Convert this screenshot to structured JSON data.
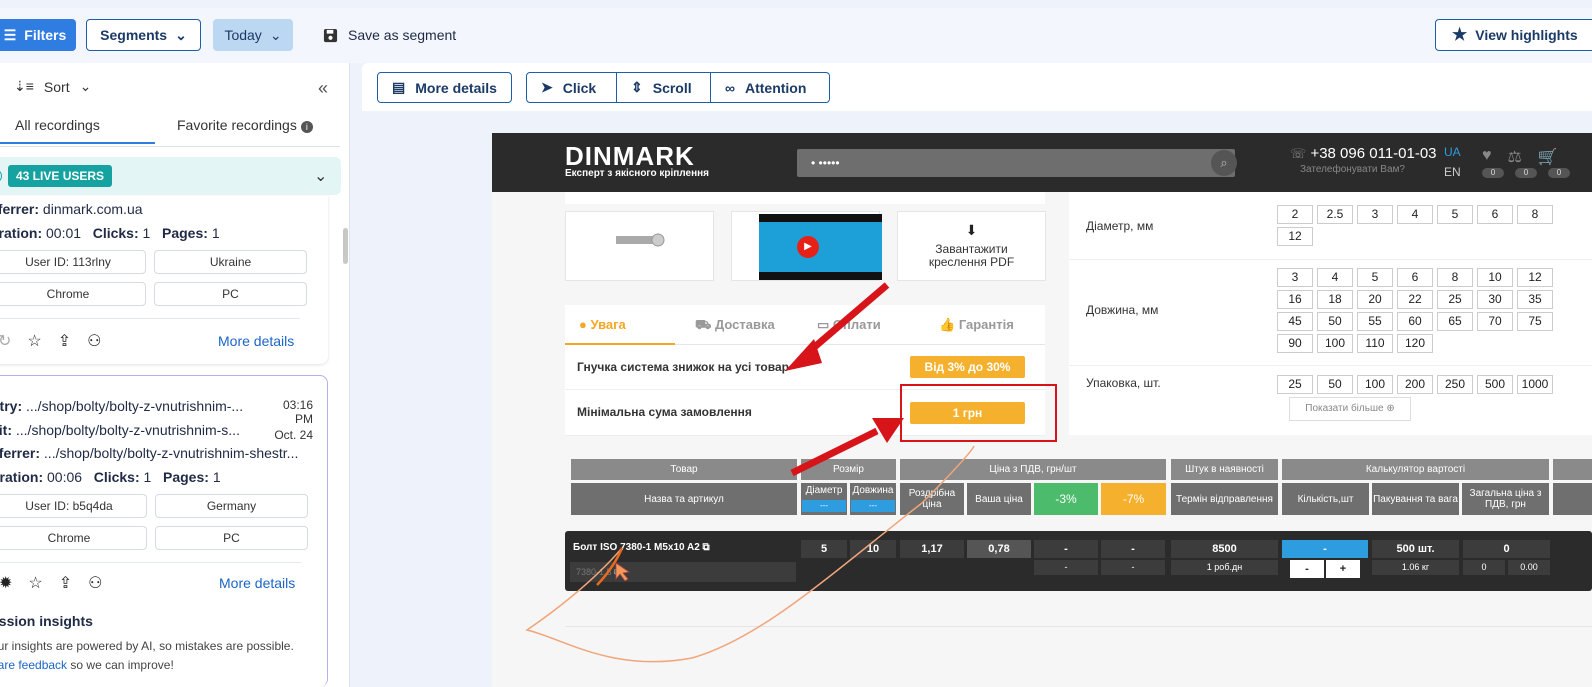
{
  "topbar": {
    "filters_label": "Filters",
    "segments_label": "Segments",
    "today_label": "Today",
    "save_segment_label": "Save as segment",
    "view_highlights_label": "View highlights"
  },
  "sidebar": {
    "sort_label": "Sort",
    "tab_all": "All recordings",
    "tab_favorite": "Favorite recordings",
    "live_users": "43 LIVE USERS",
    "session1": {
      "referrer_label": "eferrer:",
      "referrer": "dinmark.com.ua",
      "duration_label": "uration:",
      "duration": "00:01",
      "clicks_label": "Clicks:",
      "clicks": "1",
      "pages_label": "Pages:",
      "pages": "1",
      "user_id": "User ID: 113rlny",
      "country": "Ukraine",
      "browser": "Chrome",
      "device": "PC",
      "more_details": "More details"
    },
    "session2": {
      "entry_label": "ntry:",
      "entry": ".../shop/bolty/bolty-z-vnutrishnim-...",
      "exit_label": "xit:",
      "exit": ".../shop/bolty/bolty-z-vnutrishnim-s...",
      "referrer_label": "eferrer:",
      "referrer": ".../shop/bolty/bolty-z-vnutrishnim-shestr...",
      "time": "03:16 PM",
      "date": "Oct. 24",
      "duration_label": "uration:",
      "duration": "00:06",
      "clicks_label": "Clicks:",
      "clicks": "1",
      "pages_label": "Pages:",
      "pages": "1",
      "user_id": "User ID: b5q4da",
      "country": "Germany",
      "browser": "Chrome",
      "device": "PC",
      "more_details": "More details",
      "insights_title": "ession insights",
      "insights_text": "our insights are powered by AI, so mistakes are possible.",
      "feedback_link": "hare feedback",
      "feedback_rest": " so we can improve!"
    }
  },
  "player": {
    "more_details": "More details",
    "click": "Click",
    "scroll": "Scroll",
    "attention": "Attention"
  },
  "site": {
    "logo": "DINMARK",
    "logo_sub": "Експерт з якісного кріплення",
    "search_placeholder": "• •••••",
    "phone": "+38 096 011-01-03",
    "phone_sub": "Зателефонувати Вам?",
    "lang_ua": "UA",
    "lang_en": "EN",
    "counters": [
      "0",
      "0",
      "0"
    ],
    "download_pdf": "Завантажити креслення PDF",
    "tabs": [
      "Увага",
      "Доставка",
      "Оплати",
      "Гарантія"
    ],
    "discount_label": "Гнучка система знижок на усі товар",
    "discount_value": "Від 3% до 30%",
    "min_order_label": "Мінімальна сума замовлення",
    "min_order_value": "1 грн",
    "diameter_label": "Діаметр, мм",
    "diameters": [
      "2",
      "2.5",
      "3",
      "4",
      "5",
      "6",
      "8",
      "12"
    ],
    "length_label": "Довжина, мм",
    "lengths": [
      "3",
      "4",
      "5",
      "6",
      "8",
      "10",
      "12",
      "16",
      "18",
      "20",
      "22",
      "25",
      "30",
      "35",
      "45",
      "50",
      "55",
      "60",
      "65",
      "70",
      "75",
      "90",
      "100",
      "110",
      "120"
    ],
    "pack_label": "Упаковка, шт.",
    "packs": [
      "25",
      "50",
      "100",
      "200",
      "250",
      "500",
      "1000"
    ],
    "show_more": "Показати більше",
    "table": {
      "h_product": "Товар",
      "h_size": "Розмір",
      "h_price": "Ціна з ПДВ, грн/шт",
      "h_stock": "Штук в наявності",
      "h_calc": "Калькулятор вартості",
      "h_name": "Назва та артикул",
      "h_diameter": "Діаметр",
      "h_length": "Довжина",
      "h_retail": "Роздрібна ціна",
      "h_your": "Ваша ціна",
      "h_3": "-3%",
      "h_7": "-7%",
      "h_ship": "Термін відправлення",
      "h_qty": "Кількість,шт",
      "h_pack": "Пакування та вага",
      "h_total": "Загальна ціна з ПДВ, грн",
      "sel": "---"
    },
    "product": {
      "name": "Болт ISO 7380-1 M5x10 A2",
      "sku": "7380-1 5",
      "diameter": "5",
      "length": "10",
      "retail": "1,17",
      "your": "0,78",
      "p3": "-",
      "p7": "-",
      "p3b": "-",
      "p7b": "-",
      "stock": "8500",
      "ship": "1 роб.дн",
      "qty": "-",
      "minus": "-",
      "plus": "+",
      "pack": "500 шт.",
      "weight": "1.06 кг",
      "total": "0",
      "total_a": "0",
      "total_b": "0.00"
    }
  }
}
